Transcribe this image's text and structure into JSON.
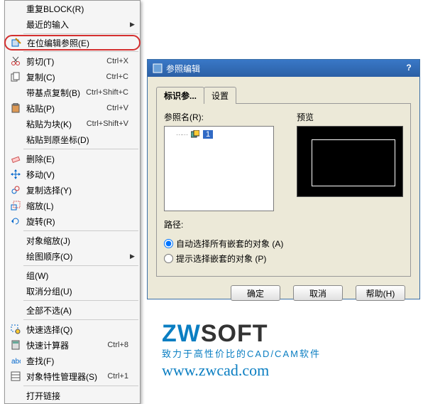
{
  "menu": {
    "items": [
      {
        "label": "重复BLOCK(R)",
        "shortcut": "",
        "arrow": false,
        "icon": "",
        "sep": false
      },
      {
        "label": "最近的输入",
        "shortcut": "",
        "arrow": true,
        "icon": "",
        "sep": false
      },
      {
        "sep": true
      },
      {
        "label": "在位编辑参照(E)",
        "shortcut": "",
        "arrow": false,
        "icon": "edit-ref-icon",
        "highlighted": true,
        "sep": false
      },
      {
        "sep": true
      },
      {
        "label": "剪切(T)",
        "shortcut": "Ctrl+X",
        "arrow": false,
        "icon": "cut-icon",
        "sep": false
      },
      {
        "label": "复制(C)",
        "shortcut": "Ctrl+C",
        "arrow": false,
        "icon": "copy-icon",
        "sep": false
      },
      {
        "label": "带基点复制(B)",
        "shortcut": "Ctrl+Shift+C",
        "arrow": false,
        "icon": "",
        "sep": false
      },
      {
        "label": "粘贴(P)",
        "shortcut": "Ctrl+V",
        "arrow": false,
        "icon": "paste-icon",
        "sep": false
      },
      {
        "label": "粘贴为块(K)",
        "shortcut": "Ctrl+Shift+V",
        "arrow": false,
        "icon": "",
        "sep": false
      },
      {
        "label": "粘贴到原坐标(D)",
        "shortcut": "",
        "arrow": false,
        "icon": "",
        "sep": false
      },
      {
        "sep": true
      },
      {
        "label": "删除(E)",
        "shortcut": "",
        "arrow": false,
        "icon": "erase-icon",
        "sep": false
      },
      {
        "label": "移动(V)",
        "shortcut": "",
        "arrow": false,
        "icon": "move-icon",
        "sep": false
      },
      {
        "label": "复制选择(Y)",
        "shortcut": "",
        "arrow": false,
        "icon": "copysel-icon",
        "sep": false
      },
      {
        "label": "缩放(L)",
        "shortcut": "",
        "arrow": false,
        "icon": "scale-icon",
        "sep": false
      },
      {
        "label": "旋转(R)",
        "shortcut": "",
        "arrow": false,
        "icon": "rotate-icon",
        "sep": false
      },
      {
        "sep": true
      },
      {
        "label": "对象缩放(J)",
        "shortcut": "",
        "arrow": false,
        "icon": "",
        "sep": false
      },
      {
        "label": "绘图顺序(O)",
        "shortcut": "",
        "arrow": true,
        "icon": "",
        "sep": false
      },
      {
        "sep": true
      },
      {
        "label": "组(W)",
        "shortcut": "",
        "arrow": false,
        "icon": "",
        "sep": false
      },
      {
        "label": "取消分组(U)",
        "shortcut": "",
        "arrow": false,
        "icon": "",
        "sep": false
      },
      {
        "sep": true
      },
      {
        "label": "全部不选(A)",
        "shortcut": "",
        "arrow": false,
        "icon": "",
        "sep": false
      },
      {
        "sep": true
      },
      {
        "label": "快速选择(Q)",
        "shortcut": "",
        "arrow": false,
        "icon": "qselect-icon",
        "sep": false
      },
      {
        "label": "快速计算器",
        "shortcut": "Ctrl+8",
        "arrow": false,
        "icon": "calc-icon",
        "sep": false
      },
      {
        "label": "查找(F)",
        "shortcut": "",
        "arrow": false,
        "icon": "find-icon",
        "sep": false
      },
      {
        "label": "对象特性管理器(S)",
        "shortcut": "Ctrl+1",
        "arrow": false,
        "icon": "props-icon",
        "sep": false
      },
      {
        "sep": true
      },
      {
        "label": "打开链接",
        "shortcut": "",
        "arrow": false,
        "icon": "",
        "sep": false
      }
    ]
  },
  "dialog": {
    "title": "参照编辑",
    "help": "?",
    "tabs": {
      "identify": "标识参...",
      "settings": "设置"
    },
    "ref_name_label": "参照名(R):",
    "preview_label": "预览",
    "tree_node_value": "1",
    "path_label": "路径:",
    "radio_auto": "自动选择所有嵌套的对象 (A)",
    "radio_prompt": "提示选择嵌套的对象 (P)",
    "buttons": {
      "ok": "确定",
      "cancel": "取消",
      "help": "帮助(H)"
    }
  },
  "logo": {
    "brand_z": "ZW",
    "brand_soft": "SOFT",
    "tagline": "致力于高性价比的CAD/CAM软件",
    "url": "www.zwcad.com"
  }
}
